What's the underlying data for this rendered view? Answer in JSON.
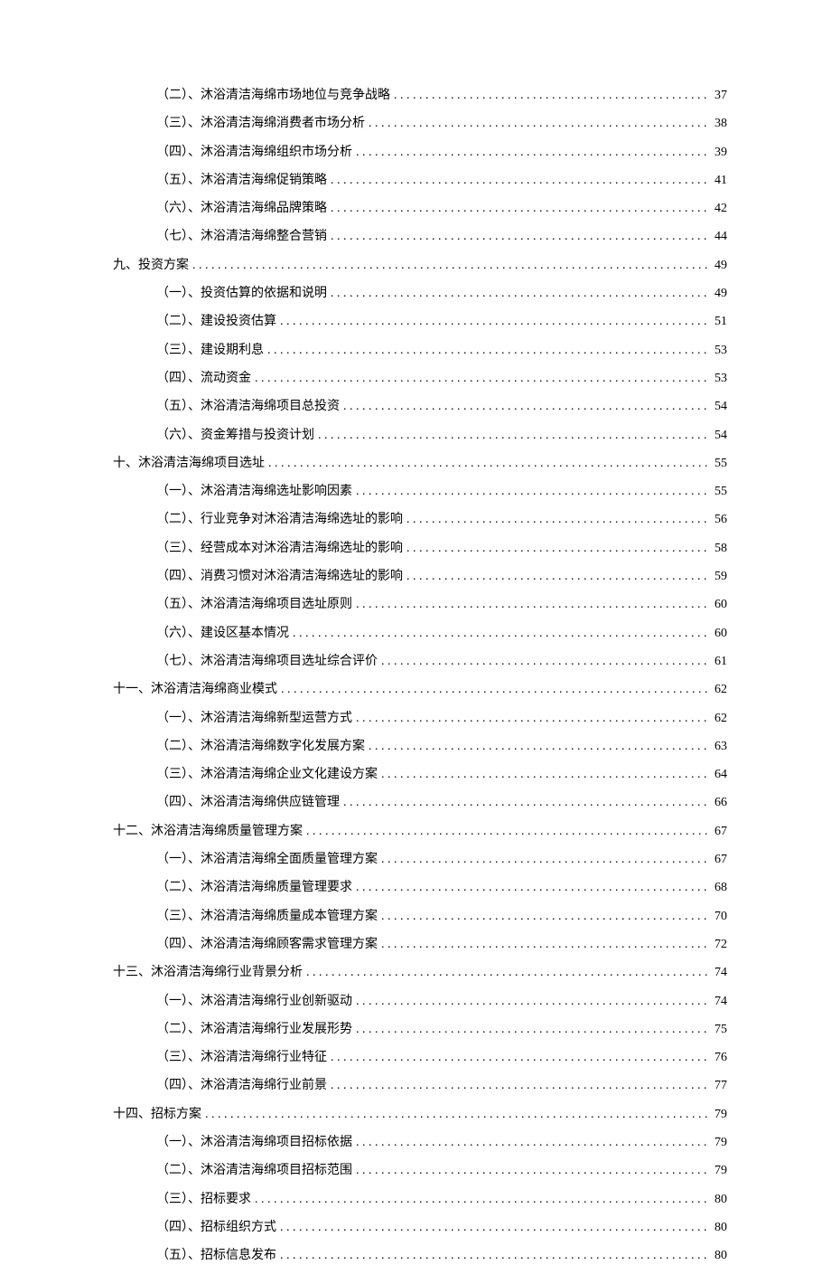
{
  "toc": [
    {
      "level": 2,
      "title": "（二）、沐浴清洁海绵市场地位与竞争战略",
      "page": "37"
    },
    {
      "level": 2,
      "title": "（三）、沐浴清洁海绵消费者市场分析",
      "page": "38"
    },
    {
      "level": 2,
      "title": "（四）、沐浴清洁海绵组织市场分析",
      "page": "39"
    },
    {
      "level": 2,
      "title": "（五）、沐浴清洁海绵促销策略",
      "page": "41"
    },
    {
      "level": 2,
      "title": "（六）、沐浴清洁海绵品牌策略",
      "page": "42"
    },
    {
      "level": 2,
      "title": "（七）、沐浴清洁海绵整合营销",
      "page": "44"
    },
    {
      "level": 1,
      "title": "九、投资方案",
      "page": "49"
    },
    {
      "level": 2,
      "title": "（一）、投资估算的依据和说明",
      "page": "49"
    },
    {
      "level": 2,
      "title": "（二）、建设投资估算",
      "page": "51"
    },
    {
      "level": 2,
      "title": "（三）、建设期利息",
      "page": "53"
    },
    {
      "level": 2,
      "title": "（四）、流动资金",
      "page": "53"
    },
    {
      "level": 2,
      "title": "（五）、沐浴清洁海绵项目总投资",
      "page": "54"
    },
    {
      "level": 2,
      "title": "（六）、资金筹措与投资计划",
      "page": "54"
    },
    {
      "level": 1,
      "title": "十、沐浴清洁海绵项目选址",
      "page": "55"
    },
    {
      "level": 2,
      "title": "（一）、沐浴清洁海绵选址影响因素",
      "page": "55"
    },
    {
      "level": 2,
      "title": "（二）、行业竞争对沐浴清洁海绵选址的影响",
      "page": "56"
    },
    {
      "level": 2,
      "title": "（三）、经营成本对沐浴清洁海绵选址的影响",
      "page": "58"
    },
    {
      "level": 2,
      "title": "（四）、消费习惯对沐浴清洁海绵选址的影响",
      "page": "59"
    },
    {
      "level": 2,
      "title": "（五）、沐浴清洁海绵项目选址原则",
      "page": "60"
    },
    {
      "level": 2,
      "title": "（六）、建设区基本情况",
      "page": "60"
    },
    {
      "level": 2,
      "title": "（七）、沐浴清洁海绵项目选址综合评价",
      "page": "61"
    },
    {
      "level": 1,
      "title": "十一、沐浴清洁海绵商业模式",
      "page": "62"
    },
    {
      "level": 2,
      "title": "（一）、沐浴清洁海绵新型运营方式",
      "page": "62"
    },
    {
      "level": 2,
      "title": "（二）、沐浴清洁海绵数字化发展方案",
      "page": "63"
    },
    {
      "level": 2,
      "title": "（三）、沐浴清洁海绵企业文化建设方案",
      "page": "64"
    },
    {
      "level": 2,
      "title": "（四）、沐浴清洁海绵供应链管理",
      "page": "66"
    },
    {
      "level": 1,
      "title": "十二、沐浴清洁海绵质量管理方案",
      "page": "67"
    },
    {
      "level": 2,
      "title": "（一）、沐浴清洁海绵全面质量管理方案",
      "page": "67"
    },
    {
      "level": 2,
      "title": "（二）、沐浴清洁海绵质量管理要求",
      "page": "68"
    },
    {
      "level": 2,
      "title": "（三）、沐浴清洁海绵质量成本管理方案",
      "page": "70"
    },
    {
      "level": 2,
      "title": "（四）、沐浴清洁海绵顾客需求管理方案",
      "page": "72"
    },
    {
      "level": 1,
      "title": "十三、沐浴清洁海绵行业背景分析",
      "page": "74"
    },
    {
      "level": 2,
      "title": "（一）、沐浴清洁海绵行业创新驱动",
      "page": "74"
    },
    {
      "level": 2,
      "title": "（二）、沐浴清洁海绵行业发展形势",
      "page": "75"
    },
    {
      "level": 2,
      "title": "（三）、沐浴清洁海绵行业特征",
      "page": "76"
    },
    {
      "level": 2,
      "title": "（四）、沐浴清洁海绵行业前景",
      "page": "77"
    },
    {
      "level": 1,
      "title": "十四、招标方案",
      "page": "79"
    },
    {
      "level": 2,
      "title": "（一）、沐浴清洁海绵项目招标依据",
      "page": "79"
    },
    {
      "level": 2,
      "title": "（二）、沐浴清洁海绵项目招标范围",
      "page": "79"
    },
    {
      "level": 2,
      "title": "（三）、招标要求",
      "page": "80"
    },
    {
      "level": 2,
      "title": "（四）、招标组织方式",
      "page": "80"
    },
    {
      "level": 2,
      "title": "（五）、招标信息发布",
      "page": "80"
    }
  ]
}
